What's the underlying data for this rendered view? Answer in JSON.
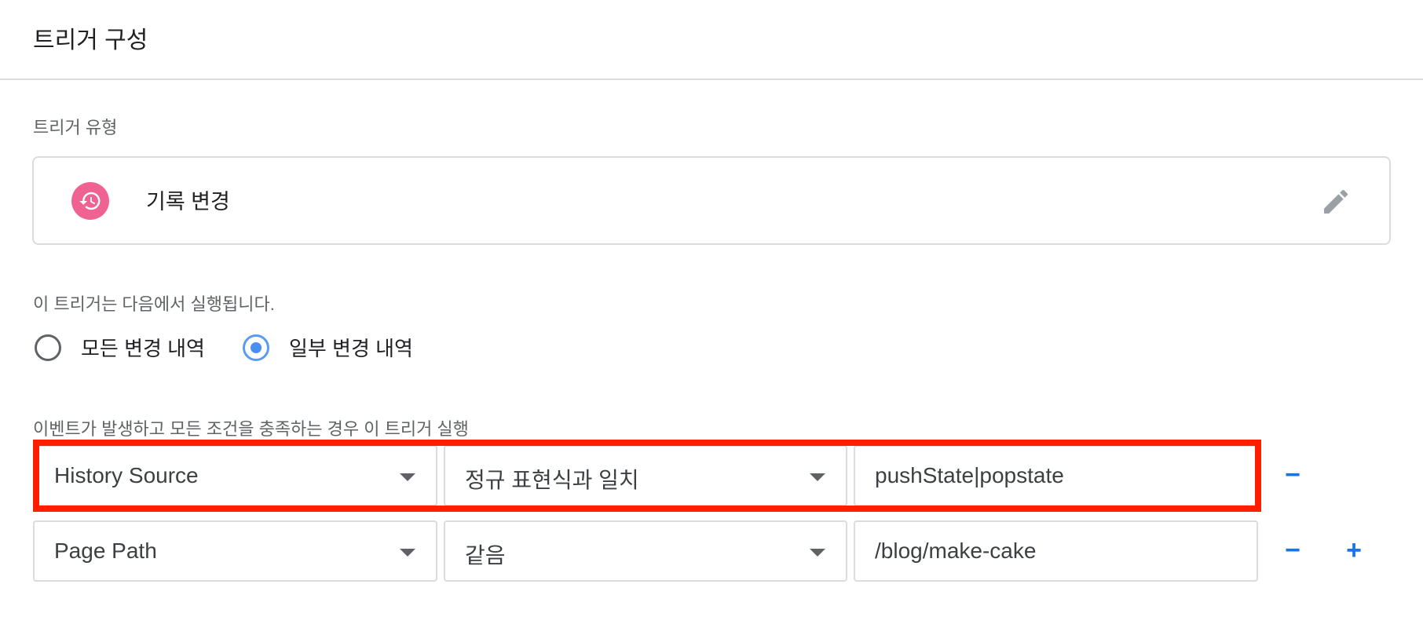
{
  "header": {
    "title": "트리거 구성"
  },
  "trigger_type": {
    "label": "트리거 유형",
    "name": "기록 변경",
    "icon": "history-icon",
    "icon_color": "#f06292"
  },
  "fires_on": {
    "label": "이 트리거는 다음에서 실행됩니다.",
    "options": [
      {
        "label": "모든 변경 내역",
        "selected": false
      },
      {
        "label": "일부 변경 내역",
        "selected": true
      }
    ]
  },
  "conditions": {
    "label": "이벤트가 발생하고 모든 조건을 충족하는 경우 이 트리거 실행",
    "rows": [
      {
        "variable": "History Source",
        "operator": "정규 표현식과 일치",
        "value": "pushState|popstate",
        "remove_label": "−"
      },
      {
        "variable": "Page Path",
        "operator": "같음",
        "value": "/blog/make-cake",
        "remove_label": "−",
        "add_label": "+"
      }
    ]
  },
  "colors": {
    "accent": "#1a73e8",
    "radio_selected": "#4a8ff0",
    "highlight_border": "#ff1e00"
  }
}
